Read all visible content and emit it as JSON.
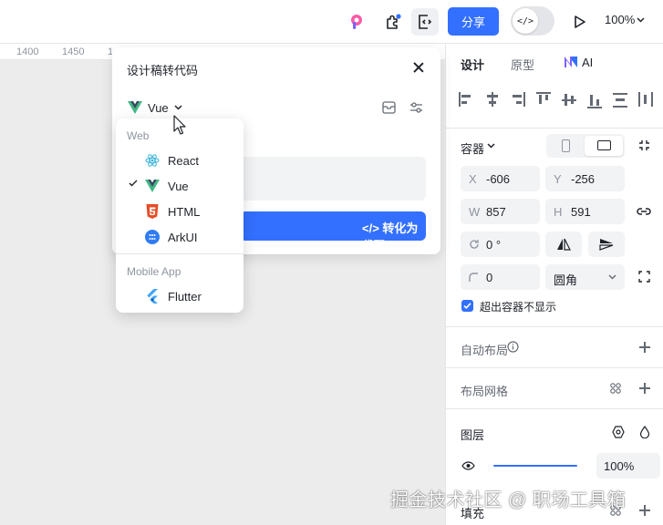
{
  "topbar": {
    "share_label": "分享",
    "toggle_label": "</>",
    "zoom": "100%"
  },
  "ruler": {
    "ticks": [
      "1400",
      "1450",
      "1"
    ]
  },
  "dialog": {
    "title": "设计稿转代码",
    "framework": "Vue",
    "convert_button": "</> 转化为代码"
  },
  "dropdown": {
    "groups": [
      {
        "label": "Web",
        "items": [
          {
            "label": "React",
            "icon": "react-icon"
          },
          {
            "label": "Vue",
            "icon": "vue-icon",
            "selected": true
          },
          {
            "label": "HTML",
            "icon": "html5-icon"
          },
          {
            "label": "ArkUI",
            "icon": "arkui-icon"
          }
        ]
      },
      {
        "label": "Mobile App",
        "items": [
          {
            "label": "Flutter",
            "icon": "flutter-icon"
          }
        ]
      }
    ]
  },
  "panel": {
    "tabs": [
      "设计",
      "原型",
      "AI"
    ],
    "container_label": "容器",
    "x_label": "X",
    "x_value": "-606",
    "y_label": "Y",
    "y_value": "-256",
    "w_label": "W",
    "w_value": "857",
    "h_label": "H",
    "h_value": "591",
    "rotation": "0 °",
    "radius": "0",
    "corner_type": "圆角",
    "clip_label": "超出容器不显示",
    "auto_layout": "自动布局",
    "layout_grid": "布局网格",
    "layer": "图层",
    "opacity": "100%",
    "fill": "填充"
  },
  "watermark": "掘金技术社区 @ 职场工具箱",
  "colors": {
    "accent": "#3370ff",
    "vue_green": "#41b883",
    "html_orange": "#e44d26",
    "react_cyan": "#3ab3d9",
    "flutter_blue": "#42a5f5"
  }
}
